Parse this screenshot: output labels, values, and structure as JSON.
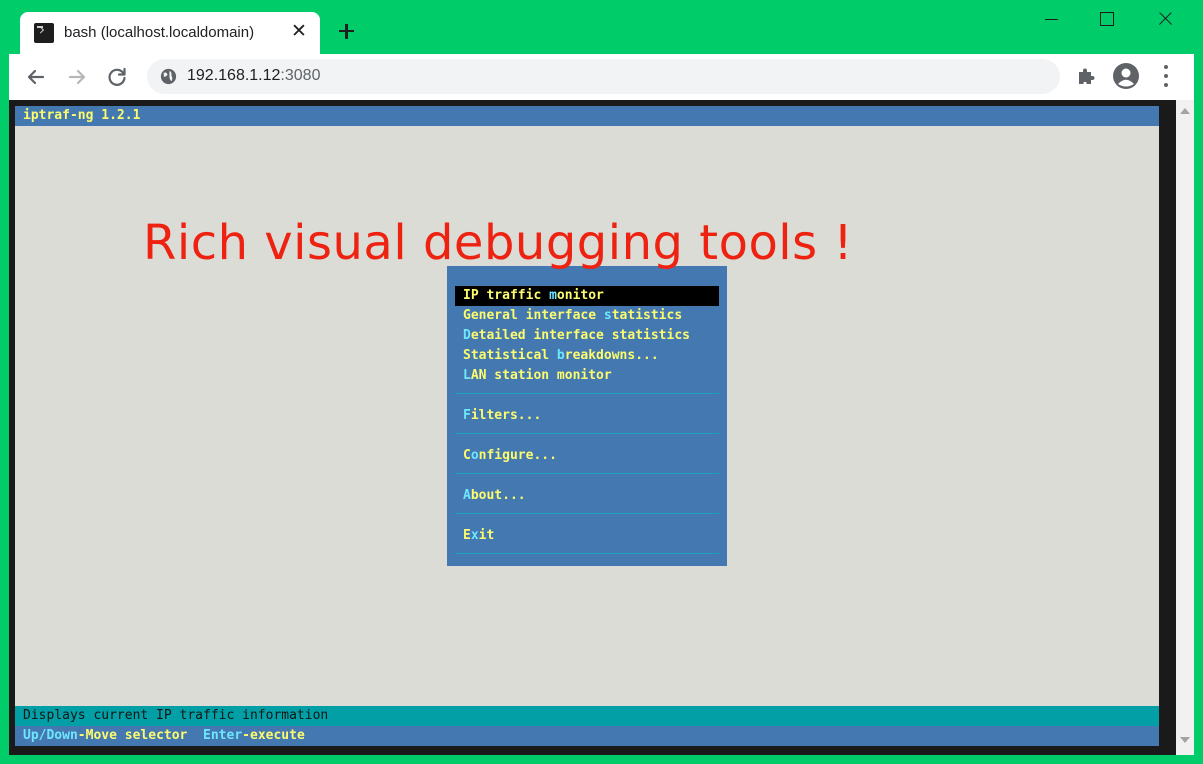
{
  "browser": {
    "tab_title": "bash (localhost.localdomain)",
    "tab_close": "✕",
    "url_host": "192.168.1.12",
    "url_port": ":3080"
  },
  "terminal": {
    "app_title": "iptraf-ng 1.2.1",
    "menu": [
      {
        "pre": "IP traffic ",
        "hk": "m",
        "post": "onitor",
        "selected": true
      },
      {
        "pre": "General interface ",
        "hk": "s",
        "post": "tatistics",
        "selected": false
      },
      {
        "pre": "",
        "hk": "D",
        "post": "etailed interface statistics",
        "selected": false
      },
      {
        "pre": "Statistical ",
        "hk": "b",
        "post": "reakdowns...",
        "selected": false
      },
      {
        "pre": "",
        "hk": "L",
        "post": "AN station monitor",
        "selected": false
      },
      {
        "pre": "",
        "hk": "F",
        "post": "ilters...",
        "selected": false
      },
      {
        "pre": "C",
        "hk": "o",
        "post": "nfigure...",
        "selected": false
      },
      {
        "pre": "",
        "hk": "A",
        "post": "bout...",
        "selected": false
      },
      {
        "pre": "E",
        "hk": "x",
        "post": "it",
        "selected": false
      }
    ],
    "status_line": "Displays current IP traffic information",
    "keys": [
      {
        "key": "Up/Down",
        "desc": "-Move selector"
      },
      {
        "key": "Enter",
        "desc": "-execute"
      }
    ]
  },
  "overlay": {
    "text": "Rich visual debugging tools !"
  },
  "colors": {
    "chrome_frame": "#00cc6a",
    "terminal_blue": "#4478b0",
    "terminal_yellow": "#fcfc6e",
    "terminal_cyan": "#6ee6ff",
    "status_teal": "#02a0a6",
    "overlay_red": "#ee2211"
  }
}
